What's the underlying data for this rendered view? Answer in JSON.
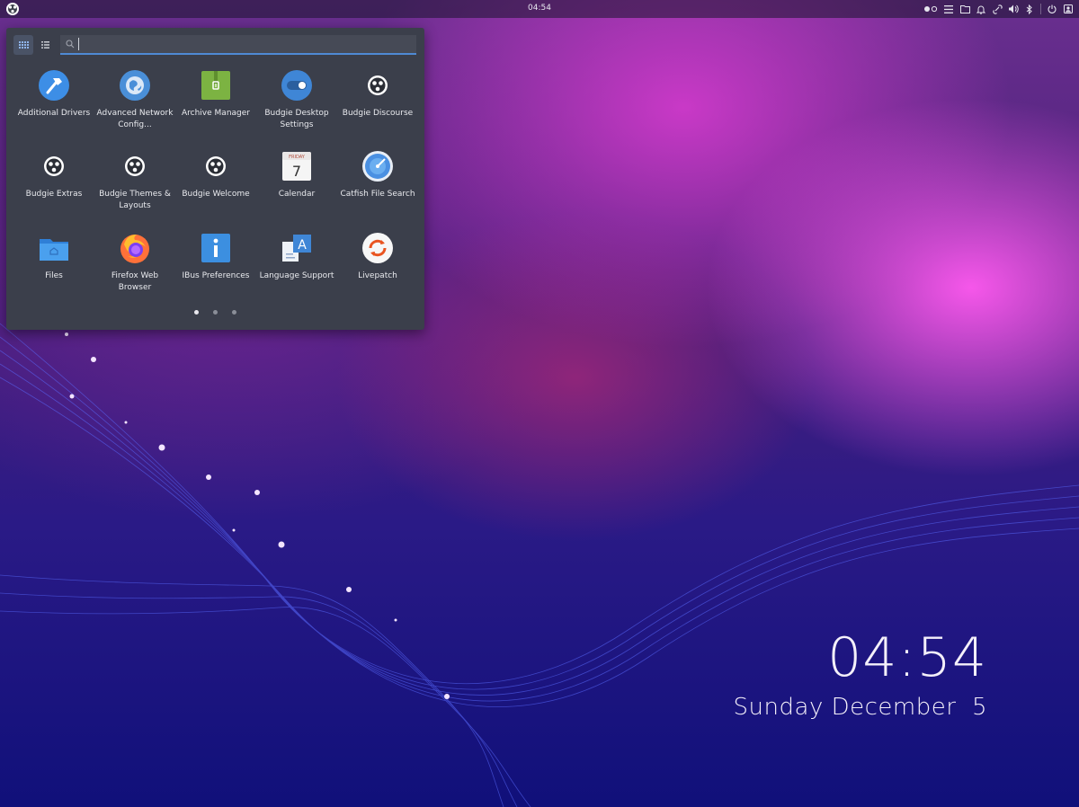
{
  "panel": {
    "clock": "04:54",
    "tray_icons": [
      "workspace-indicator-icon",
      "menu-icon",
      "notifications-icon",
      "network-icon",
      "volume-icon",
      "bluetooth-icon",
      "power-icon",
      "user-icon"
    ]
  },
  "menu": {
    "search": {
      "value": "",
      "placeholder": ""
    },
    "apps": [
      {
        "label": "Additional Drivers",
        "icon": "additional-drivers-icon"
      },
      {
        "label": "Advanced Network Config...",
        "icon": "network-config-icon"
      },
      {
        "label": "Archive Manager",
        "icon": "archive-manager-icon"
      },
      {
        "label": "Budgie Desktop Settings",
        "icon": "budgie-settings-icon"
      },
      {
        "label": "Budgie Discourse",
        "icon": "budgie-discourse-icon"
      },
      {
        "label": "Budgie Extras",
        "icon": "budgie-extras-icon"
      },
      {
        "label": "Budgie Themes & Layouts",
        "icon": "budgie-themes-icon"
      },
      {
        "label": "Budgie Welcome",
        "icon": "budgie-welcome-icon"
      },
      {
        "label": "Calendar",
        "icon": "calendar-icon"
      },
      {
        "label": "Catfish File Search",
        "icon": "catfish-icon"
      },
      {
        "label": "Files",
        "icon": "files-icon"
      },
      {
        "label": "Firefox Web Browser",
        "icon": "firefox-icon"
      },
      {
        "label": "IBus Preferences",
        "icon": "ibus-icon"
      },
      {
        "label": "Language Support",
        "icon": "language-support-icon"
      },
      {
        "label": "Livepatch",
        "icon": "livepatch-icon"
      }
    ],
    "calendar_icon": {
      "day_name": "FRIDAY",
      "day_number": "7"
    },
    "pages": 3,
    "current_page": 1
  },
  "desktop_clock": {
    "time": "04:54",
    "date": "Sunday December  5"
  },
  "colors": {
    "menu_bg": "#3b3f4b",
    "accent": "#4f8ad4"
  }
}
